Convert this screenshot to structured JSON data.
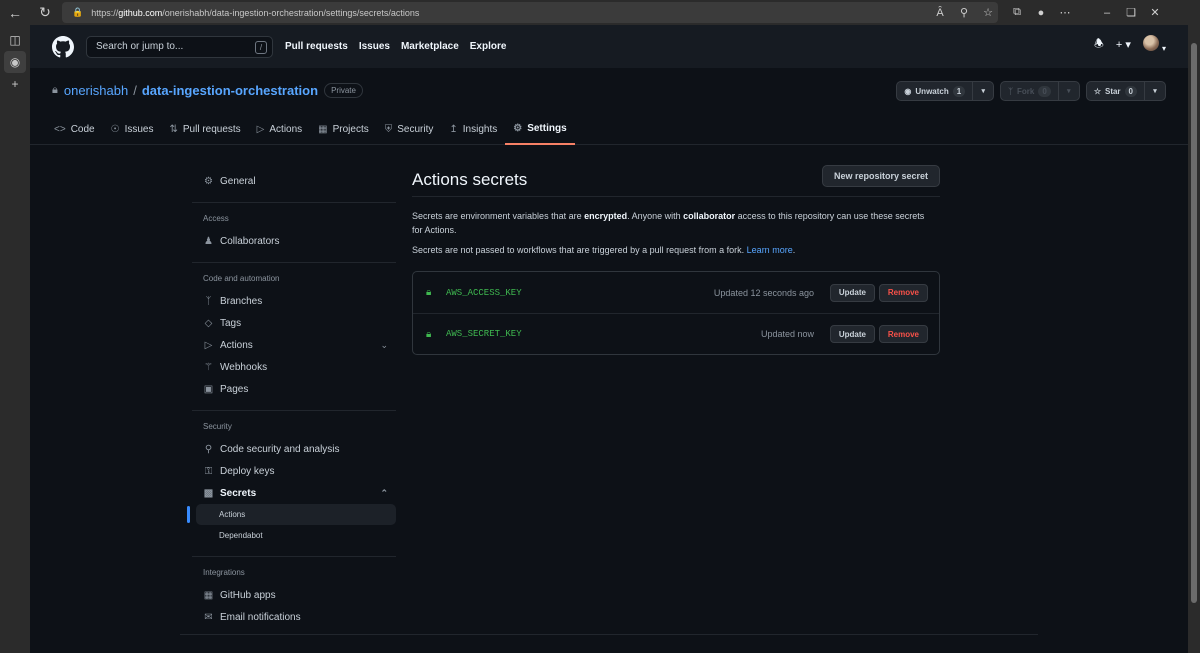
{
  "browser": {
    "url_prefix": "https://",
    "url_host": "github.com",
    "url_path": "/onerishabh/data-ingestion-orchestration/settings/secrets/actions"
  },
  "header": {
    "search_placeholder": "Search or jump to...",
    "search_shortcut": "/",
    "nav": [
      "Pull requests",
      "Issues",
      "Marketplace",
      "Explore"
    ]
  },
  "repo": {
    "owner": "onerishabh",
    "separator": "/",
    "name": "data-ingestion-orchestration",
    "visibility": "Private",
    "watch_label": "Unwatch",
    "watch_count": "1",
    "fork_label": "Fork",
    "fork_count": "0",
    "star_label": "Star",
    "star_count": "0"
  },
  "tabs": [
    {
      "label": "Code",
      "icon": "code-icon"
    },
    {
      "label": "Issues",
      "icon": "issue-icon"
    },
    {
      "label": "Pull requests",
      "icon": "pull-request-icon"
    },
    {
      "label": "Actions",
      "icon": "play-icon"
    },
    {
      "label": "Projects",
      "icon": "table-icon"
    },
    {
      "label": "Security",
      "icon": "shield-icon"
    },
    {
      "label": "Insights",
      "icon": "graph-icon"
    },
    {
      "label": "Settings",
      "icon": "gear-icon",
      "selected": true
    }
  ],
  "sidebar": {
    "general": "General",
    "access_heading": "Access",
    "collaborators": "Collaborators",
    "code_heading": "Code and automation",
    "branches": "Branches",
    "tags": "Tags",
    "actions": "Actions",
    "webhooks": "Webhooks",
    "pages": "Pages",
    "security_heading": "Security",
    "code_security": "Code security and analysis",
    "deploy_keys": "Deploy keys",
    "secrets": "Secrets",
    "secrets_actions": "Actions",
    "secrets_dependabot": "Dependabot",
    "integrations_heading": "Integrations",
    "github_apps": "GitHub apps",
    "email_notifications": "Email notifications"
  },
  "main": {
    "title": "Actions secrets",
    "new_secret_button": "New repository secret",
    "desc_1": "Secrets are environment variables that are ",
    "desc_bold_1": "encrypted",
    "desc_2": ". Anyone with ",
    "desc_bold_2": "collaborator",
    "desc_3": " access to this repository can use these secrets for Actions.",
    "desc2_text": "Secrets are not passed to workflows that are triggered by a pull request from a fork. ",
    "learn_more": "Learn more",
    "desc2_end": ".",
    "secrets": [
      {
        "name": "AWS_ACCESS_KEY",
        "updated": "Updated 12 seconds ago",
        "update_label": "Update",
        "remove_label": "Remove"
      },
      {
        "name": "AWS_SECRET_KEY",
        "updated": "Updated now",
        "update_label": "Update",
        "remove_label": "Remove"
      }
    ]
  },
  "colors": {
    "accent": "#58a6ff",
    "selected_tab_underline": "#f78166",
    "secret_green": "#3fb950",
    "danger": "#f85149"
  }
}
